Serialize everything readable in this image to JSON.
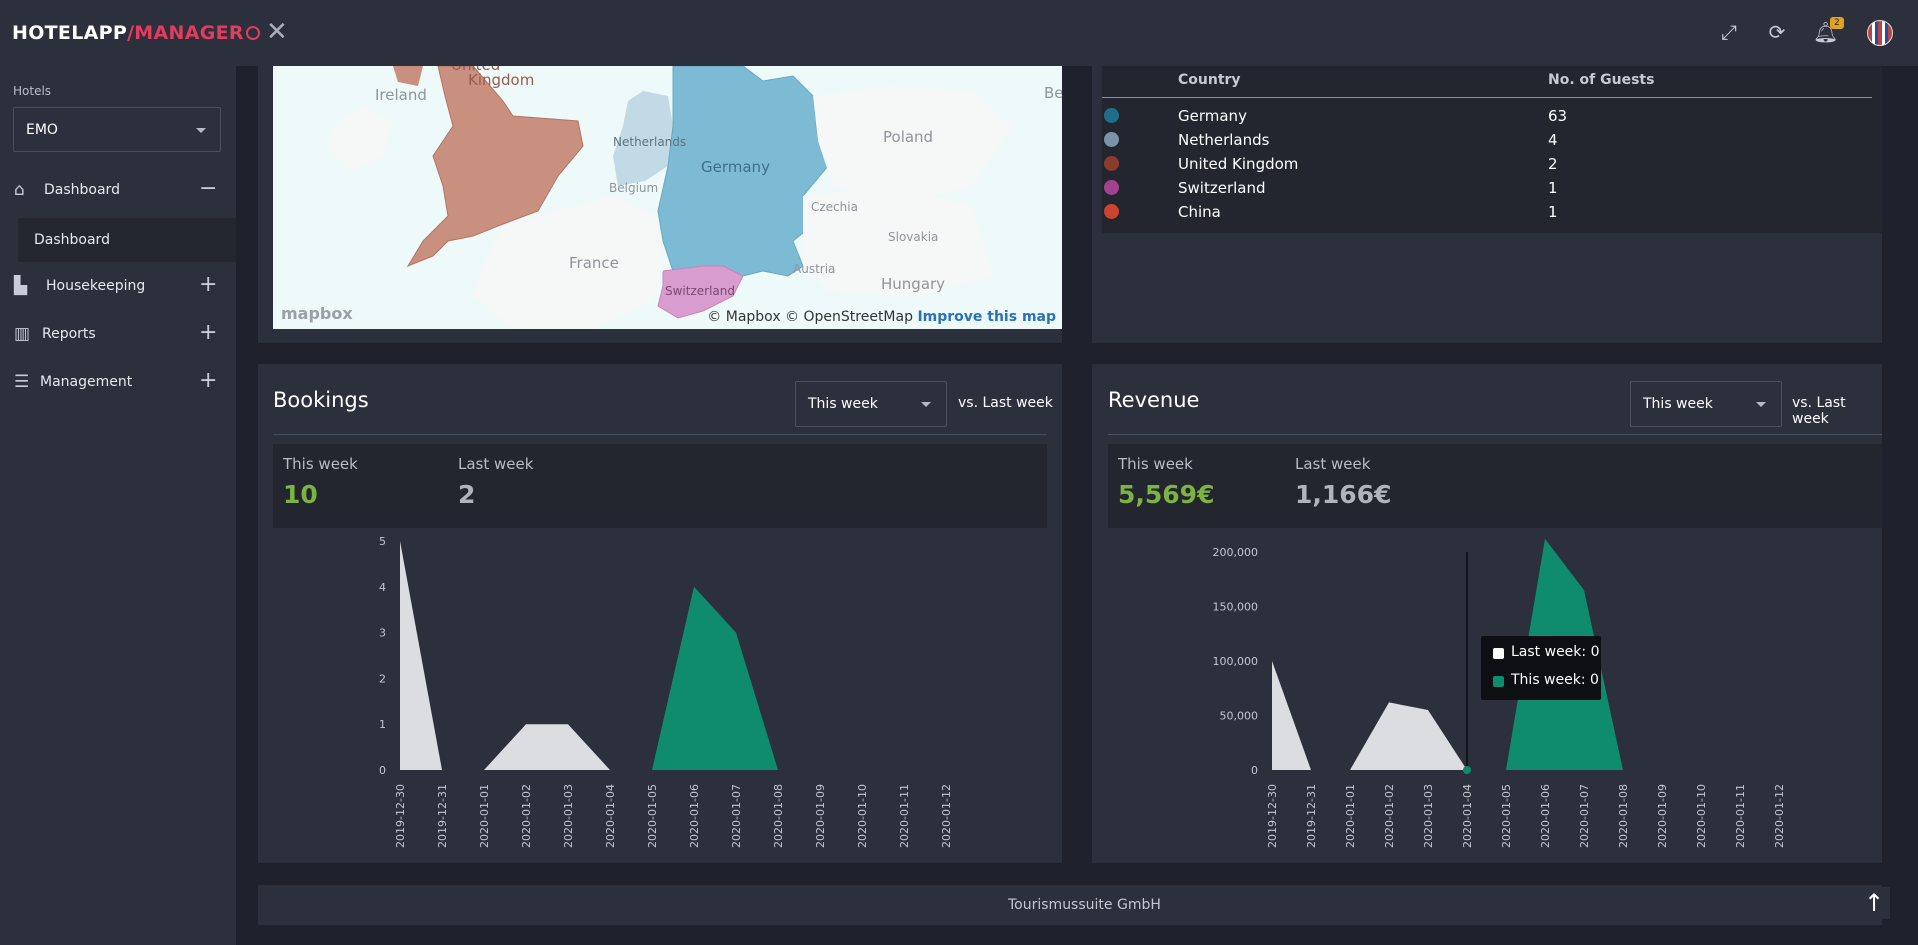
{
  "app": {
    "brand_part1": "HOTELAPP",
    "brand_part2": "/MANAGER",
    "brand_color": "#e23c5f",
    "notifications_count": "2"
  },
  "topbar": {
    "icons": [
      "fullscreen-icon",
      "refresh-icon",
      "bell-icon",
      "avatar"
    ]
  },
  "sidebar": {
    "hotels_label": "Hotels",
    "hotel_selected": "EMO",
    "items": [
      {
        "label": "Dashboard",
        "icon": "home-icon",
        "expanded": true
      },
      {
        "label": "Housekeeping",
        "icon": "building-icon",
        "expanded": false
      },
      {
        "label": "Reports",
        "icon": "bar-chart-icon",
        "expanded": false
      },
      {
        "label": "Management",
        "icon": "database-icon",
        "expanded": false
      }
    ],
    "sub_item": "Dashboard"
  },
  "map": {
    "labels": [
      "Ireland",
      "United",
      "Kingdom",
      "Netherlands",
      "Belgium",
      "Germany",
      "Poland",
      "Czechia",
      "Slovakia",
      "France",
      "Austria",
      "Hungary",
      "Switzerland",
      "Be"
    ],
    "logo": "mapbox",
    "attribution": "© Mapbox © OpenStreetMap",
    "improve": "Improve this map"
  },
  "guests_table": {
    "headers": [
      "Country",
      "No. of Guests"
    ],
    "rows": [
      {
        "country": "Germany",
        "guests": "63",
        "color": "#1f6f8b"
      },
      {
        "country": "Netherlands",
        "guests": "4",
        "color": "#7b95a8"
      },
      {
        "country": "United Kingdom",
        "guests": "2",
        "color": "#8b3a2d"
      },
      {
        "country": "Switzerland",
        "guests": "1",
        "color": "#a2428f"
      },
      {
        "country": "China",
        "guests": "1",
        "color": "#c9452f"
      }
    ]
  },
  "bookings": {
    "title": "Bookings",
    "period": "This week",
    "vs": "vs. Last week",
    "this_week_label": "This week",
    "this_week_value": "10",
    "last_week_label": "Last week",
    "last_week_value": "2"
  },
  "revenue": {
    "title": "Revenue",
    "period": "This week",
    "vs": "vs. Last week",
    "this_week_label": "This week",
    "this_week_value": "5,569€",
    "last_week_label": "Last week",
    "last_week_value": "1,166€",
    "tooltip": {
      "last_week": "Last week: 0",
      "this_week": "This week: 0"
    }
  },
  "footer": {
    "text": "Tourismussuite GmbH"
  },
  "chart_data": [
    {
      "type": "area",
      "title": "Bookings",
      "x": [
        "2019-12-30",
        "2019-12-31",
        "2020-01-01",
        "2020-01-02",
        "2020-01-03",
        "2020-01-04",
        "2020-01-05",
        "2020-01-06",
        "2020-01-07",
        "2020-01-08",
        "2020-01-09",
        "2020-01-10",
        "2020-01-11",
        "2020-01-12"
      ],
      "ylim": [
        0,
        5
      ],
      "yticks": [
        "0",
        "1",
        "2",
        "3",
        "4",
        "5"
      ],
      "series": [
        {
          "name": "Last week",
          "color": "#dcdde0",
          "values": [
            5,
            0,
            0,
            1,
            1,
            0,
            null,
            null,
            null,
            null,
            null,
            null,
            null,
            null
          ]
        },
        {
          "name": "This week",
          "color": "#0f8c6e",
          "values": [
            null,
            null,
            null,
            null,
            null,
            null,
            0,
            4,
            3,
            0,
            null,
            null,
            null,
            null
          ]
        }
      ]
    },
    {
      "type": "area",
      "title": "Revenue",
      "x": [
        "2019-12-30",
        "2019-12-31",
        "2020-01-01",
        "2020-01-02",
        "2020-01-03",
        "2020-01-04",
        "2020-01-05",
        "2020-01-06",
        "2020-01-07",
        "2020-01-08",
        "2020-01-09",
        "2020-01-10",
        "2020-01-11",
        "2020-01-12"
      ],
      "ylim": [
        0,
        200000
      ],
      "yticks": [
        "0",
        "50,000",
        "100,000",
        "150,000",
        "200,000"
      ],
      "series": [
        {
          "name": "Last week",
          "color": "#dcdde0",
          "values": [
            100000,
            0,
            0,
            62000,
            55000,
            0,
            null,
            null,
            null,
            null,
            null,
            null,
            null,
            null
          ]
        },
        {
          "name": "This week",
          "color": "#0f8c6e",
          "values": [
            null,
            null,
            null,
            null,
            null,
            0,
            0,
            212000,
            165000,
            0,
            null,
            null,
            null,
            null
          ]
        }
      ]
    }
  ]
}
